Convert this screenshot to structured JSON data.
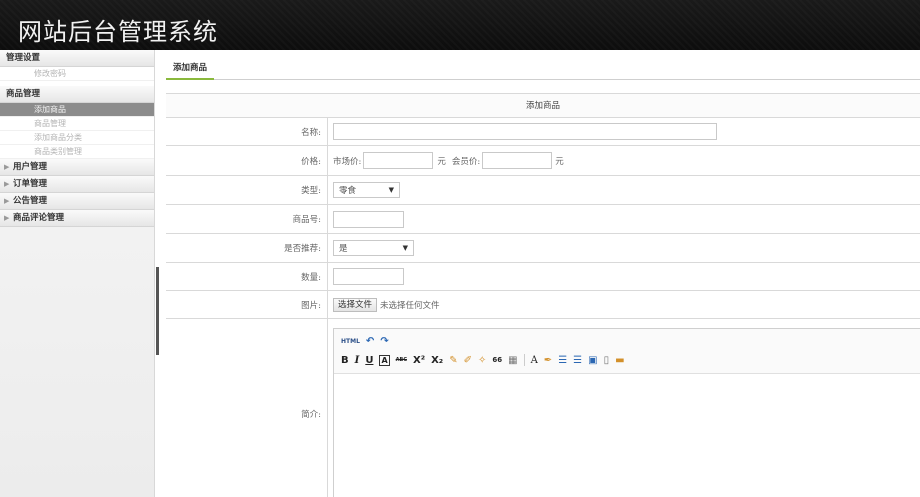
{
  "header": {
    "title": "网站后台管理系统"
  },
  "sidebar": {
    "groups": [
      {
        "label": "管理设置",
        "items": [
          "修改密码"
        ]
      },
      {
        "label": "商品管理",
        "items": [
          "添加商品",
          "商品管理",
          "添加商品分类",
          "商品类别管理"
        ],
        "active_index": 0
      },
      {
        "label": "用户管理"
      },
      {
        "label": "订单管理"
      },
      {
        "label": "公告管理"
      },
      {
        "label": "商品评论管理"
      }
    ]
  },
  "tab": {
    "label": "添加商品"
  },
  "form": {
    "caption": "添加商品",
    "name_label": "名称:",
    "price_label": "价格:",
    "market_price_label": "市场价:",
    "unit": "元",
    "member_price_label": "会员价:",
    "type_label": "类型:",
    "type_value": "零食",
    "sku_label": "商品号:",
    "recommend_label": "是否推荐:",
    "recommend_value": "是",
    "qty_label": "数量:",
    "image_label": "图片:",
    "file_button": "选择文件",
    "file_status": "未选择任何文件",
    "intro_label": "简介:"
  },
  "editor": {
    "toolbar": {
      "row1": [
        "html-icon",
        "undo-icon",
        "redo-icon"
      ],
      "row2": [
        "bold-icon",
        "italic-icon",
        "underline-icon",
        "text-box-icon",
        "strikethrough-icon",
        "superscript-icon",
        "subscript-icon",
        "eraser-icon",
        "format-brush-icon",
        "auto-format-icon",
        "blockquote-icon",
        "paste-text-icon",
        "font-color-icon",
        "highlight-icon",
        "ordered-list-icon",
        "unordered-list-icon",
        "select-all-icon",
        "clear-doc-icon",
        "media-icon"
      ],
      "glyphs": {
        "html": "HTML",
        "undo": "↶",
        "redo": "↷",
        "bold": "B",
        "italic": "I",
        "underline": "U",
        "textbox": "A",
        "strike": "ABC",
        "sup": "X²",
        "sub": "X₂",
        "quote": "66",
        "fontcolor": "A"
      }
    }
  },
  "colors": {
    "header_bg": "#111111",
    "active_item_bg": "#8c8c8c",
    "tab_underline": "#8ab93c"
  }
}
